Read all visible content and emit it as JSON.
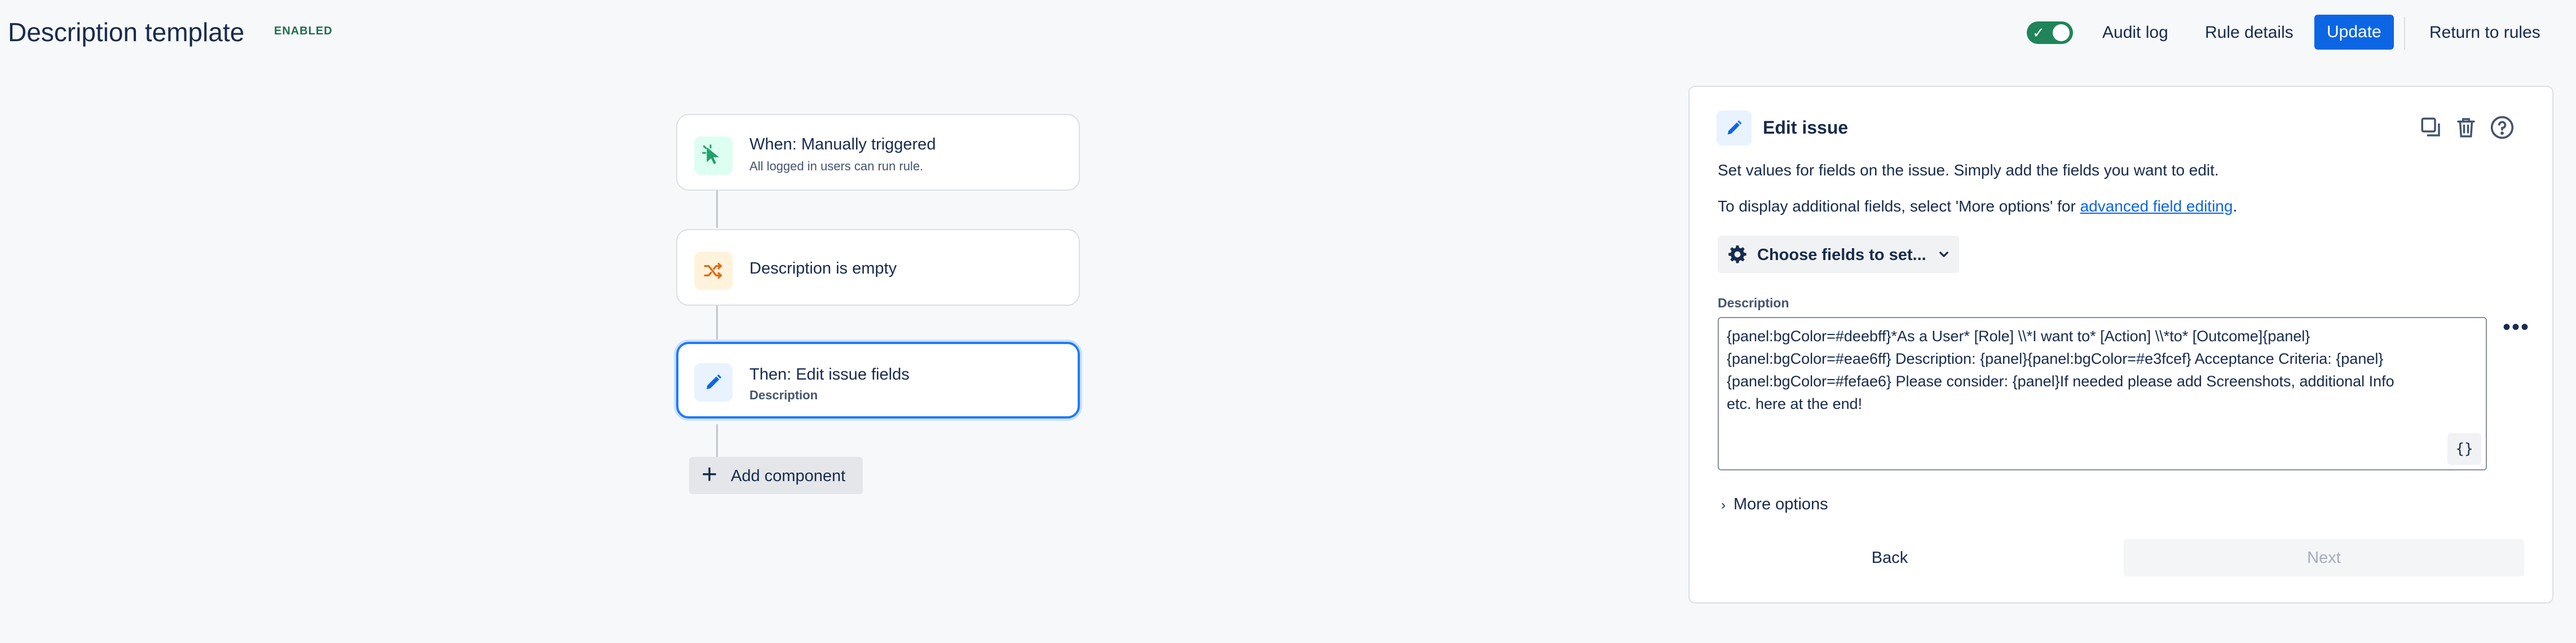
{
  "header": {
    "title": "Description template",
    "status": "ENABLED",
    "toggle_on": true,
    "audit_log": "Audit log",
    "rule_details": "Rule details",
    "update": "Update",
    "return_to_rules": "Return to rules"
  },
  "flow": {
    "trigger": {
      "title": "When: Manually triggered",
      "subtitle": "All logged in users can run rule.",
      "icon": "cursor-click-icon"
    },
    "condition": {
      "title": "Description is empty",
      "icon": "shuffle-branch-icon"
    },
    "action": {
      "title": "Then: Edit issue fields",
      "subtitle": "Description",
      "icon": "pencil-icon"
    },
    "add_component": "Add component"
  },
  "panel": {
    "title": "Edit issue",
    "intro": "Set values for fields on the issue. Simply add the fields you want to edit.",
    "hint_prefix": "To display additional fields, select 'More options' for ",
    "hint_link": "advanced field editing",
    "hint_suffix": ".",
    "choose_fields": "Choose fields to set...",
    "field_label": "Description",
    "field_value": "{panel:bgColor=#deebff}*As a User* [Role] \\\\*I want to* [Action] \\\\*to* [Outcome]{panel}\n{panel:bgColor=#eae6ff} Description: {panel}{panel:bgColor=#e3fcef} Acceptance Criteria: {panel}\n{panel:bgColor=#fefae6} Please consider: {panel}If needed please add Screenshots, additional Info\netc. here at the end!",
    "smart_value_button": "{}",
    "more_options": "More options",
    "back": "Back",
    "next": "Next"
  },
  "colors": {
    "accent": "#0C66E4",
    "toggle_on": "#1F845A",
    "selected_border": "#1D7AFC",
    "enabled_text": "#216E4E"
  }
}
